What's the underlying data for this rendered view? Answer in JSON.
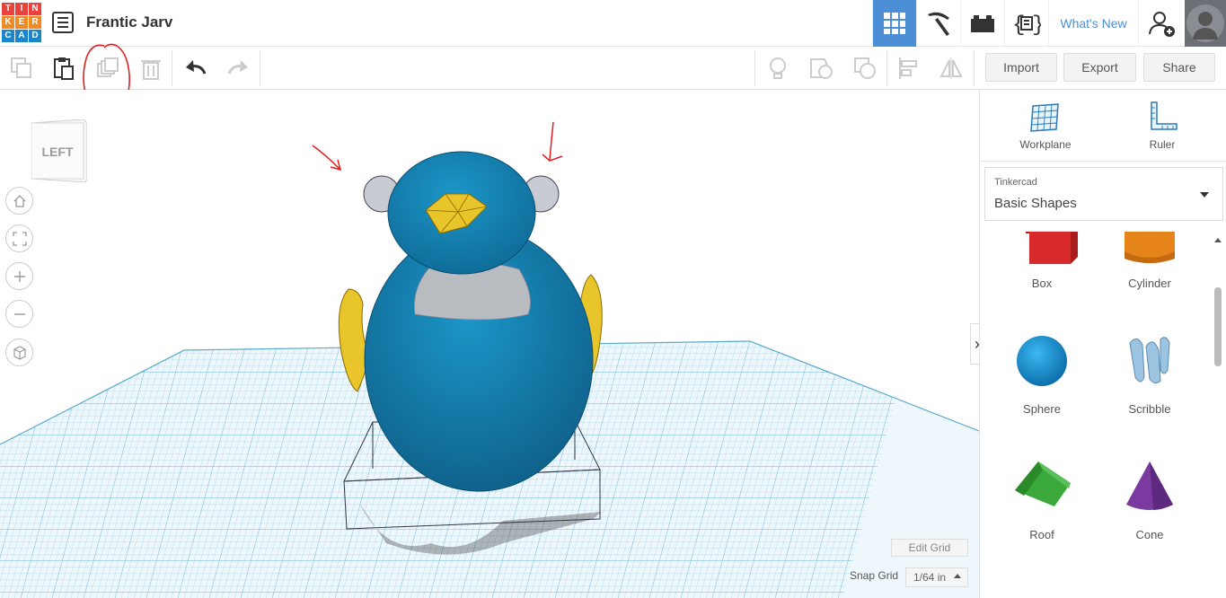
{
  "app": {
    "logo_letters": [
      "T",
      "I",
      "N",
      "K",
      "E",
      "R",
      "C",
      "A",
      "D"
    ],
    "logo_colors": [
      "#e9423c",
      "#e9423c",
      "#e9423c",
      "#f08a24",
      "#f08a24",
      "#f08a24",
      "#1a86c8",
      "#1a86c8",
      "#1a86c8"
    ],
    "project_title": "Frantic Jarv"
  },
  "header": {
    "whats_new": "What's New",
    "accent": "#4c8fd6",
    "icons": [
      "3d-design-grid-icon",
      "pickaxe-icon",
      "bricks-icon",
      "codeblocks-icon",
      "add-user-icon",
      "avatar"
    ]
  },
  "toolbar": {
    "import_label": "Import",
    "export_label": "Export",
    "share_label": "Share",
    "icons": [
      "copy-icon",
      "paste-icon",
      "duplicate-icon",
      "delete-icon",
      "undo-icon",
      "redo-icon",
      "notes-icon",
      "group-icon",
      "ungroup-icon",
      "align-icon",
      "mirror-icon"
    ]
  },
  "viewport": {
    "view_cube_label": "LEFT",
    "edit_grid_label": "Edit Grid",
    "snap_grid_label": "Snap Grid",
    "snap_grid_value": "1/64 in",
    "model_color": "#1a86b4",
    "accent_yellow": "#e8c52a",
    "annotation_color": "#e02020"
  },
  "panel": {
    "workplane_label": "Workplane",
    "ruler_label": "Ruler",
    "library_source": "Tinkercad",
    "library_name": "Basic Shapes",
    "shapes": [
      {
        "label": "Box",
        "color": "#d82a2a"
      },
      {
        "label": "Cylinder",
        "color": "#e5851a"
      },
      {
        "label": "Sphere",
        "color": "#1aa0e0"
      },
      {
        "label": "Scribble",
        "color": "#8ab8d8"
      },
      {
        "label": "Roof",
        "color": "#3aa83a"
      },
      {
        "label": "Cone",
        "color": "#7a3aa0"
      }
    ]
  }
}
